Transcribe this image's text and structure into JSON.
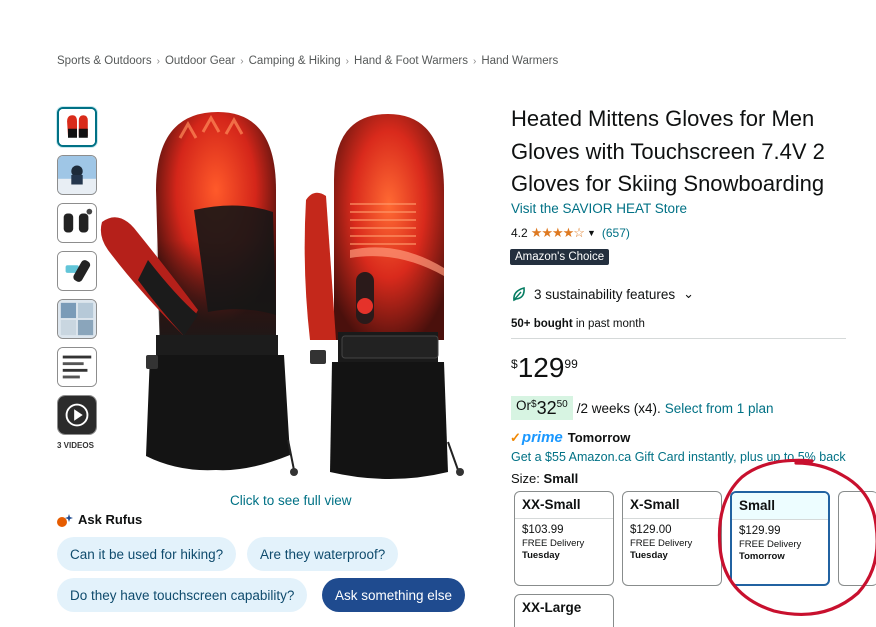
{
  "breadcrumb": [
    "Sports & Outdoors",
    "Outdoor Gear",
    "Camping & Hiking",
    "Hand & Foot Warmers",
    "Hand Warmers"
  ],
  "gallery": {
    "videos_label": "3 VIDEOS",
    "full_view_text": "Click to see full view"
  },
  "rufus": {
    "title": "Ask Rufus",
    "questions": [
      "Can it be used for hiking?",
      "Are they waterproof?",
      "Do they have touchscreen capability?"
    ],
    "ask_else": "Ask something else"
  },
  "product": {
    "title_lines": [
      "Heated Mittens Gloves for Men",
      "Gloves with Touchscreen 7.4V 2",
      "Gloves for Skiing Snowboarding"
    ],
    "store_link": "Visit the SAVIOR HEAT Store",
    "rating": "4.2",
    "stars": "★★★★☆",
    "rating_count": "(657)",
    "badge": "Amazon's Choice",
    "sustainability": "3 sustainability features",
    "bought_bold": "50+ bought",
    "bought_rest": " in past month"
  },
  "price": {
    "symbol": "$",
    "whole": "129",
    "fraction": "99"
  },
  "installment": {
    "prefix": "Or ",
    "symbol": "$",
    "whole": "32",
    "fraction": "50",
    "period": "/2 weeks (x4).",
    "link": "Select from 1 plan"
  },
  "delivery": {
    "check": "✓",
    "prime": "prime",
    "day": "Tomorrow"
  },
  "giftcard": "Get a $55 Amazon.ca Gift Card instantly, plus up to 5% back",
  "size": {
    "label": "Size:",
    "selected": "Small",
    "options": [
      {
        "name": "XX-Small",
        "price": "$103.99",
        "delivery": "FREE Delivery",
        "day": "Tuesday"
      },
      {
        "name": "X-Small",
        "price": "$129.00",
        "delivery": "FREE Delivery",
        "day": "Tuesday"
      },
      {
        "name": "Small",
        "price": "$129.99",
        "delivery": "FREE Delivery",
        "day": "Tomorrow"
      },
      {
        "name": "XX-Large",
        "price": "",
        "delivery": "",
        "day": ""
      }
    ]
  },
  "colors": {
    "link": "#007185",
    "star": "#de7921",
    "selected_border": "#2162a1",
    "annotation": "#c8102e",
    "glove_heat": "#e8301c",
    "glove_black": "#1a1a1a"
  }
}
